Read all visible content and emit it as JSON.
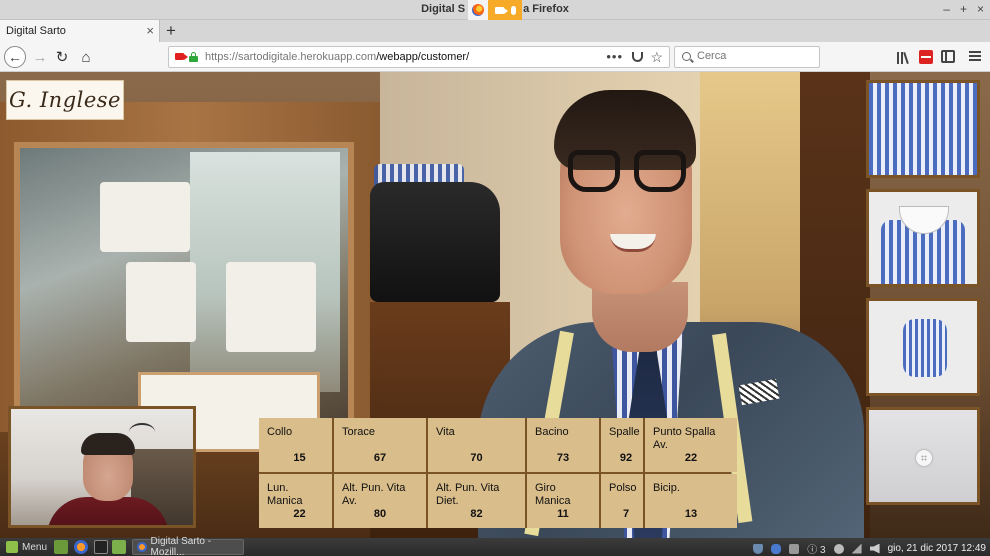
{
  "window": {
    "title": "Digital Sarto - Mozilla Firefox",
    "title_left": "Digital S",
    "title_right": "a Firefox",
    "controls": [
      "–",
      "+",
      "×"
    ]
  },
  "tab": {
    "title": "Digital Sarto",
    "close": "×",
    "new_tab": "+"
  },
  "nav": {
    "url_host": "https://sartodigitale.herokuapp.com",
    "url_path": "/webapp/customer/",
    "page_actions": "•••",
    "search_placeholder": "Cerca"
  },
  "page": {
    "logo": "G. Inglese",
    "thumbnails": [
      "fabric-swatch",
      "shirt-collar",
      "shirt-cuff",
      "shirt-button"
    ],
    "measurements": [
      {
        "label": "Collo",
        "value": "15"
      },
      {
        "label": "Torace",
        "value": "67"
      },
      {
        "label": "Vita",
        "value": "70"
      },
      {
        "label": "Bacino",
        "value": "73"
      },
      {
        "label": "Spalle",
        "value": "92"
      },
      {
        "label": "Punto Spalla Av.",
        "value": "22"
      },
      {
        "label": "Lun. Manica",
        "value": "22"
      },
      {
        "label": "Alt. Pun. Vita Av.",
        "value": "80"
      },
      {
        "label": "Alt. Pun. Vita Diet.",
        "value": "82"
      },
      {
        "label": "Giro Manica",
        "value": "11"
      },
      {
        "label": "Polso",
        "value": "7"
      },
      {
        "label": "Bicip.",
        "value": "13"
      }
    ]
  },
  "taskbar": {
    "menu": "Menu",
    "task_item": "Digital Sarto - Mozill...",
    "updates": "3",
    "clock": "gio, 21 dic 2017 12:49"
  },
  "colors": {
    "cell_bg": "#d9bd8b",
    "frame": "#7a5426",
    "share_indicator": "#f7a928"
  }
}
